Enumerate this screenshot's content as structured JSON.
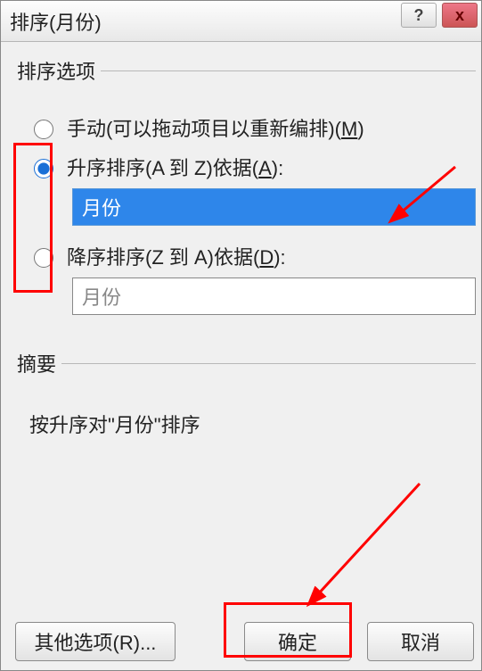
{
  "window": {
    "title": "排序(月份)",
    "help_icon": "?",
    "close_icon": "x"
  },
  "sort_options": {
    "legend": "排序选项",
    "manual_label_pre": "手动(可以拖动项目以重新编排)(",
    "manual_hotkey": "M",
    "manual_label_post": ")",
    "asc_label_pre": "升序排序(A 到 Z)依据(",
    "asc_hotkey": "A",
    "asc_label_post": "):",
    "asc_field": "月份",
    "desc_label_pre": "降序排序(Z 到 A)依据(",
    "desc_hotkey": "D",
    "desc_label_post": "):",
    "desc_field": "月份",
    "selected": "asc"
  },
  "summary": {
    "legend": "摘要",
    "text": "按升序对\"月份\"排序"
  },
  "buttons": {
    "more_options": "其他选项(R)...",
    "ok": "确定",
    "cancel": "取消"
  }
}
